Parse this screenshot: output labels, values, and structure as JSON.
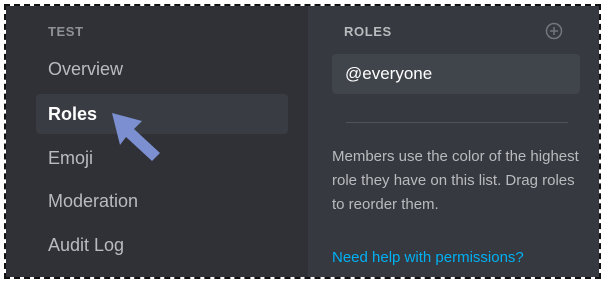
{
  "sidebar": {
    "section_header": "TEST",
    "items": [
      {
        "label": "Overview"
      },
      {
        "label": "Roles",
        "active": true
      },
      {
        "label": "Emoji"
      },
      {
        "label": "Moderation"
      },
      {
        "label": "Audit Log"
      }
    ]
  },
  "roles_panel": {
    "header": "ROLES",
    "add_icon": "plus-circle-icon",
    "roles": [
      {
        "name": "@everyone"
      }
    ],
    "description": "Members use the color of the highest role they have on this list. Drag roles to reorder them.",
    "help_link": "Need help with permissions?"
  },
  "annotation": {
    "arrow_icon": "pointer-arrow-icon",
    "arrow_color": "#7b8fd1"
  },
  "colors": {
    "sidebar_bg": "#2f3136",
    "main_bg": "#36393f",
    "link": "#00b0f4"
  }
}
